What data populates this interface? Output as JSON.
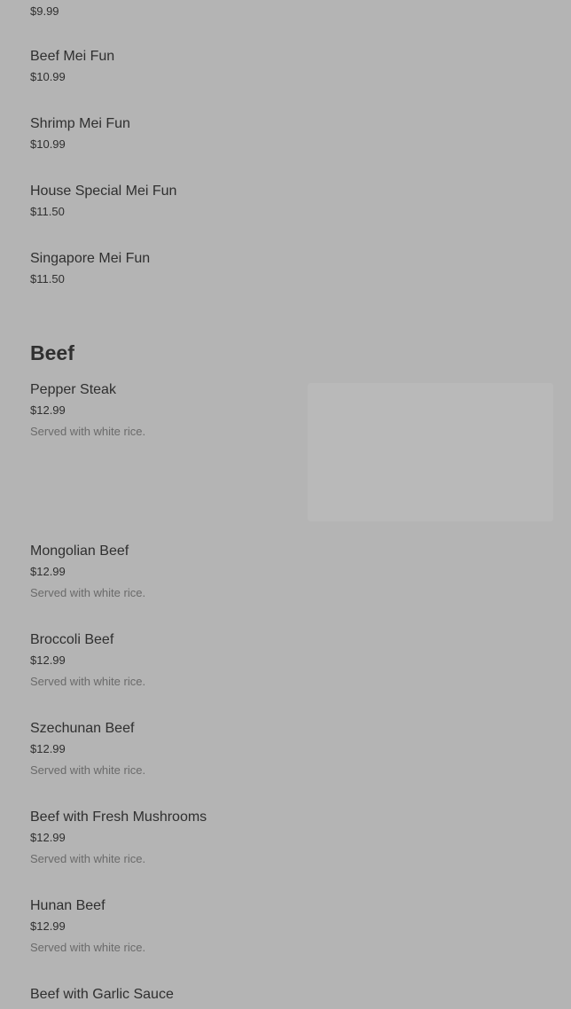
{
  "top_partial_item": {
    "price": "$9.99"
  },
  "mei_fun_items": [
    {
      "name": "Beef Mei Fun",
      "price": "$10.99"
    },
    {
      "name": "Shrimp Mei Fun",
      "price": "$10.99"
    },
    {
      "name": "House Special Mei Fun",
      "price": "$11.50"
    },
    {
      "name": "Singapore Mei Fun",
      "price": "$11.50"
    }
  ],
  "beef_section": {
    "heading": "Beef",
    "items": [
      {
        "name": "Pepper Steak",
        "price": "$12.99",
        "description": "Served with white rice."
      },
      {
        "name": "Mongolian Beef",
        "price": "$12.99",
        "description": "Served with white rice."
      },
      {
        "name": "Broccoli Beef",
        "price": "$12.99",
        "description": "Served with white rice."
      },
      {
        "name": "Szechunan Beef",
        "price": "$12.99",
        "description": "Served with white rice."
      },
      {
        "name": "Beef with Fresh Mushrooms",
        "price": "$12.99",
        "description": "Served with white rice."
      },
      {
        "name": "Hunan Beef",
        "price": "$12.99",
        "description": "Served with white rice."
      },
      {
        "name": "Beef with Garlic Sauce"
      }
    ]
  }
}
